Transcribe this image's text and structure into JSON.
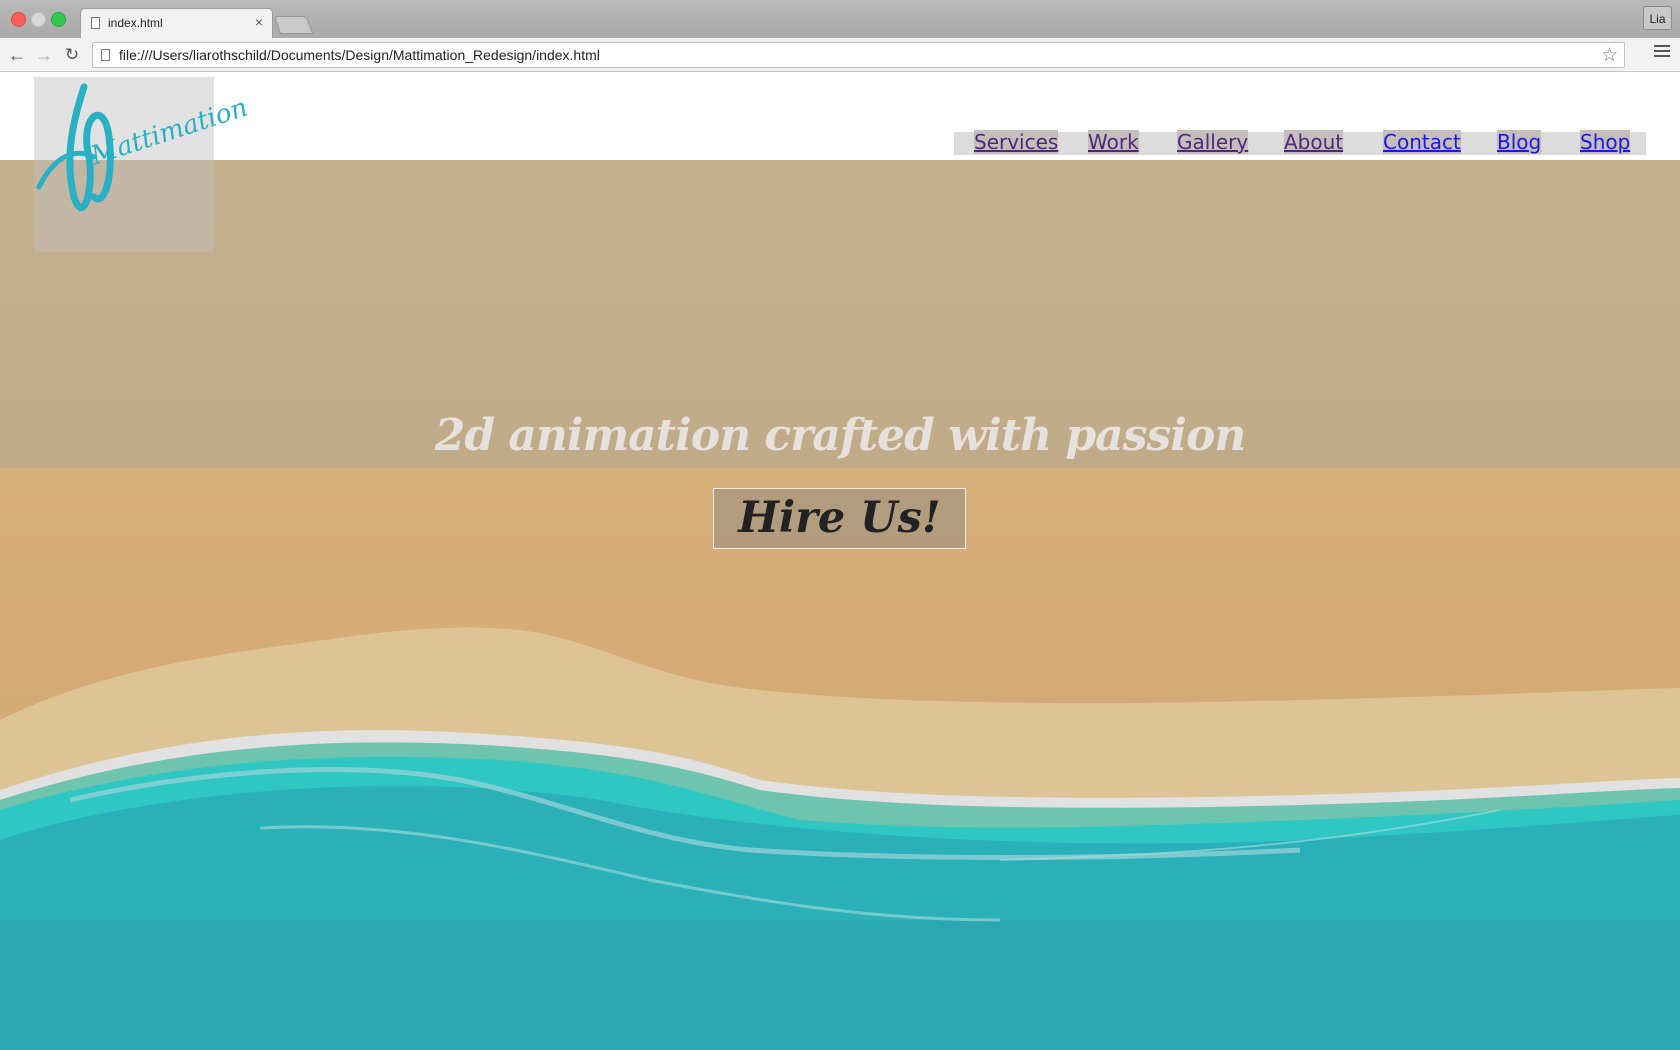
{
  "browser": {
    "tab_title": "index.html",
    "tab_close": "×",
    "profile_name": "Lia",
    "url": "file:///Users/liarothschild/Documents/Design/Mattimation_Redesign/index.html",
    "back_icon": "←",
    "forward_icon": "→",
    "reload_icon": "↻",
    "star_icon": "☆"
  },
  "site": {
    "logo_text": "Mattimation",
    "nav": {
      "services": "Services",
      "work": "Work",
      "gallery": "Gallery",
      "about": "About",
      "contact": "Contact",
      "blog": "Blog",
      "shop": "Shop"
    },
    "tagline": "2d animation crafted with passion",
    "cta": "Hire Us!"
  },
  "colors": {
    "logo": "#2ab0c4",
    "nav_visited": "#4b2a7a",
    "nav_link": "#1a1ae6",
    "sea": "#2db5bd"
  }
}
